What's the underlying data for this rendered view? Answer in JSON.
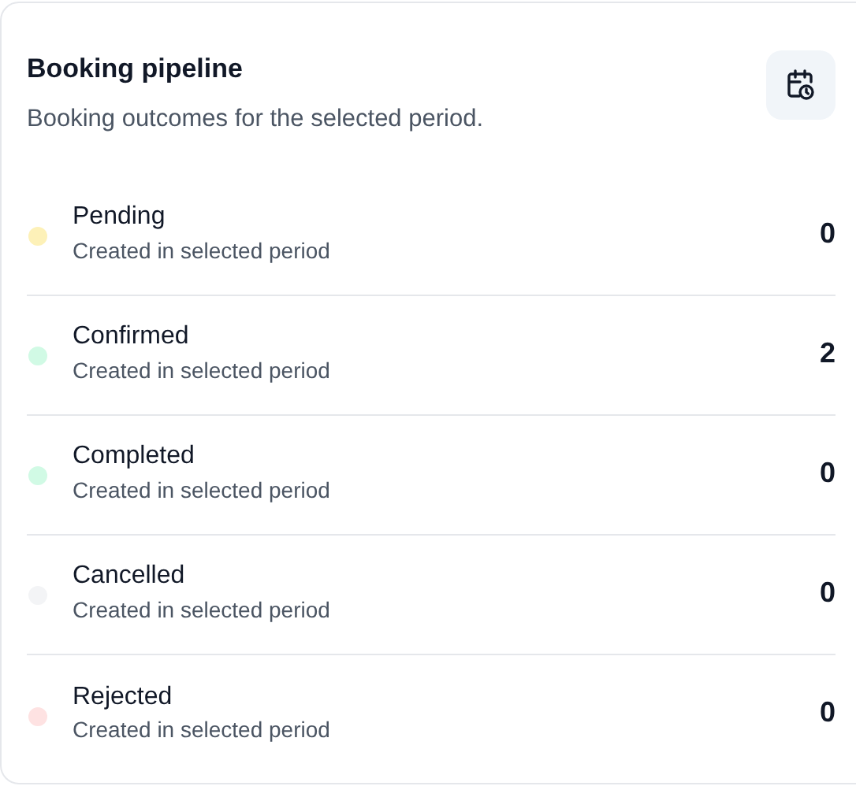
{
  "card": {
    "title": "Booking pipeline",
    "subtitle": "Booking outcomes for the selected period."
  },
  "statuses": [
    {
      "label": "Pending",
      "caption": "Created in selected period",
      "count": "0",
      "color": "#fdf1b8"
    },
    {
      "label": "Confirmed",
      "caption": "Created in selected period",
      "count": "2",
      "color": "#d1fae5"
    },
    {
      "label": "Completed",
      "caption": "Created in selected period",
      "count": "0",
      "color": "#d1fae5"
    },
    {
      "label": "Cancelled",
      "caption": "Created in selected period",
      "count": "0",
      "color": "#f3f4f6"
    },
    {
      "label": "Rejected",
      "caption": "Created in selected period",
      "count": "0",
      "color": "#fee2e2"
    }
  ]
}
